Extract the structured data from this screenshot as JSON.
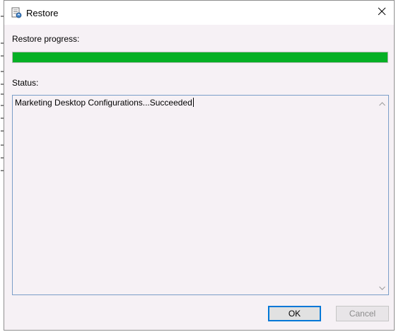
{
  "window": {
    "title": "Restore",
    "icon": "restore-document-icon",
    "close_icon": "close-icon"
  },
  "progress": {
    "label": "Restore progress:",
    "value_percent": 100,
    "color": "#06b025"
  },
  "status": {
    "label": "Status:",
    "text": "Marketing Desktop Configurations...Succeeded"
  },
  "buttons": {
    "ok_label": "OK",
    "cancel_label": "Cancel",
    "cancel_enabled": false
  },
  "colors": {
    "dialog_bg": "#f6f1f5",
    "focus_border": "#0078d7",
    "textbox_border": "#7a9ec8"
  }
}
